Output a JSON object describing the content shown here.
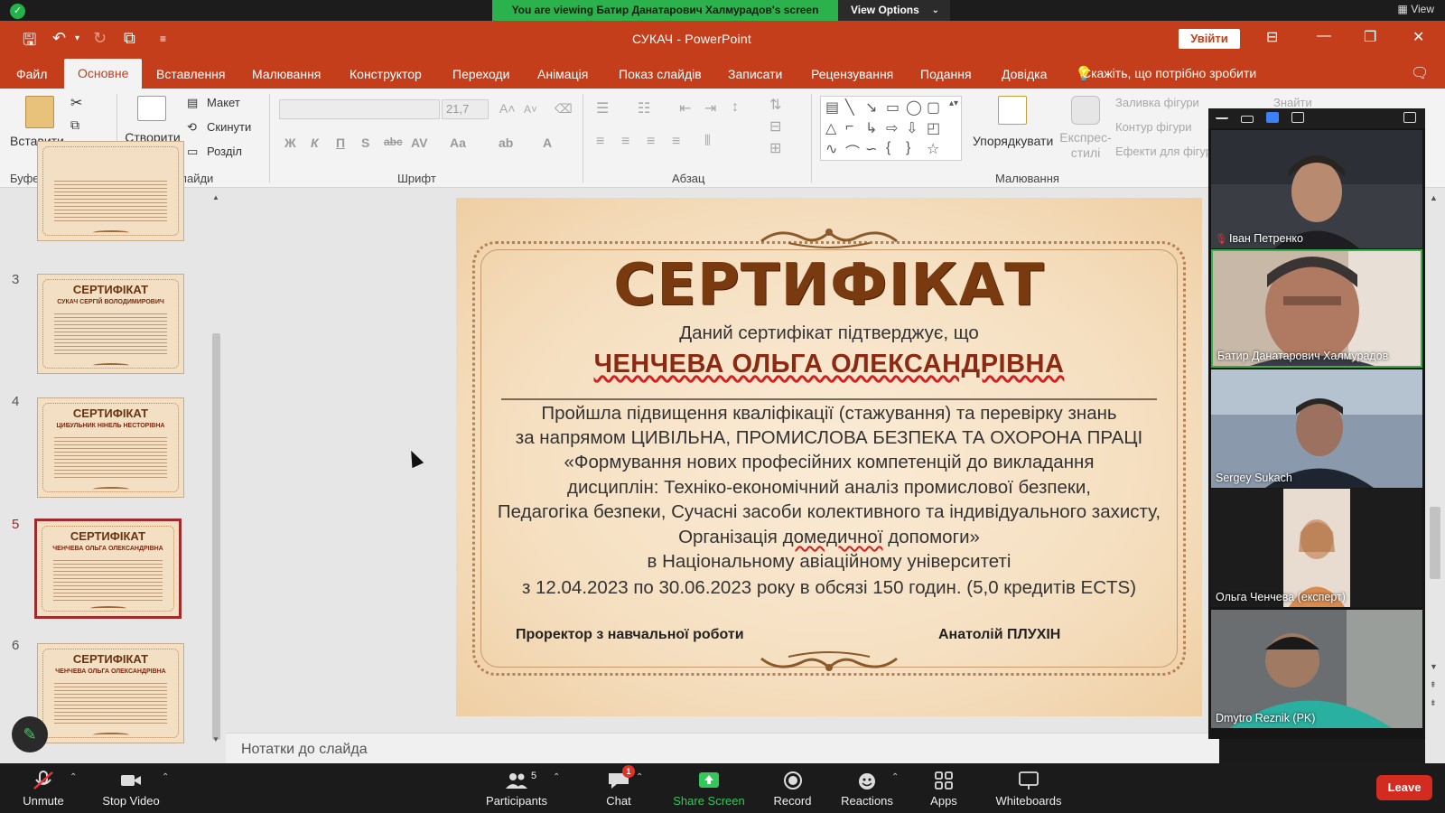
{
  "zoom": {
    "share_banner": "You are viewing Батир Данатарович Халмурадов's screen",
    "view_options": "View Options",
    "view_top": "View",
    "toolbar": {
      "unmute": "Unmute",
      "stop_video": "Stop Video",
      "participants": "Participants",
      "participants_count": "5",
      "chat": "Chat",
      "chat_badge": "1",
      "share_screen": "Share Screen",
      "record": "Record",
      "reactions": "Reactions",
      "apps": "Apps",
      "whiteboards": "Whiteboards",
      "leave": "Leave"
    },
    "participants": [
      {
        "name": "Іван Петренко",
        "muted": true
      },
      {
        "name": "Батир Данатарович Халмурадов",
        "muted": false,
        "speaking": true
      },
      {
        "name": "Sergey Sukach",
        "muted": false
      },
      {
        "name": "Ольга Ченчева (експерт)",
        "muted": false
      },
      {
        "name": "Dmytro Reznik (PK)",
        "muted": false
      }
    ]
  },
  "ppt": {
    "title": "СУКАЧ  -  PowerPoint",
    "signin": "Увійти",
    "menu": [
      "Файл",
      "Основне",
      "Вставлення",
      "Малювання",
      "Конструктор",
      "Переходи",
      "Анімація",
      "Показ слайдів",
      "Записати",
      "Рецензування",
      "Подання",
      "Довідка"
    ],
    "tell_me": "Скажіть, що потрібно зробити",
    "ribbon": {
      "paste": "Вставити",
      "clipboard_group": "Буфер обміну",
      "new_slide": "Створити слайд",
      "layout": "Макет",
      "reset": "Скинути",
      "section": "Розділ",
      "slides_group": "Слайди",
      "font_size": "21,7",
      "font_group": "Шрифт",
      "paragraph_group": "Абзац",
      "arrange": "Упорядкувати",
      "quick_styles": "Експрес-стилі",
      "shape_fill": "Заливка фігури",
      "shape_outline": "Контур фігури",
      "shape_effects": "Ефекти для фігури",
      "find": "Знайти",
      "drawing_group": "Малювання"
    },
    "thumbnails": [
      {
        "num": "",
        "title": "",
        "name": ""
      },
      {
        "num": "3",
        "title": "СЕРТИФІКАТ",
        "name": "СУКАЧ СЕРГІЙ ВОЛОДИМИРОВИЧ"
      },
      {
        "num": "4",
        "title": "СЕРТИФІКАТ",
        "name": "ЦИБУЛЬНИК НІНЕЛЬ НЕСТОРІВНА"
      },
      {
        "num": "5",
        "title": "СЕРТИФІКАТ",
        "name": "ЧЕНЧЕВА ОЛЬГА ОЛЕКСАНДРІВНА",
        "selected": true
      },
      {
        "num": "6",
        "title": "СЕРТИФІКАТ",
        "name": "ЧЕНЧЕВА ОЛЬГА ОЛЕКСАНДРІВНА"
      }
    ],
    "notes": "Нотатки до слайда",
    "slide": {
      "title": "СЕРТИФІКАТ",
      "confirm": "Даний сертифікат підтверджує, що",
      "name": "ЧЕНЧЕВА ОЛЬГА ОЛЕКСАНДРІВНА",
      "l1": "Пройшла підвищення кваліфікації (стажування) та  перевірку  знань",
      "l2": "за напрямом ЦИВІЛЬНА, ПРОМИСЛОВА БЕЗПЕКА ТА ОХОРОНА ПРАЦІ",
      "l3": "«Формування нових професійних компетенцій до викладання",
      "l4": "дисциплін: Техніко-економічний аналіз промислової безпеки,",
      "l5": "Педагогіка безпеки, Сучасні засоби колективного та індивідуального захисту,",
      "l6a": "Організація ",
      "l6b": "домедичної",
      "l6c": " допомоги»",
      "l7": "в Національному авіаційному університеті",
      "l8": "з 12.04.2023 по 30.06.2023 року в обсязі 150 годин. (5,0 кредитів ECTS)",
      "sig_left": "Проректор з навчальної роботи",
      "sig_right": "Анатолій ПЛУХІН"
    }
  }
}
